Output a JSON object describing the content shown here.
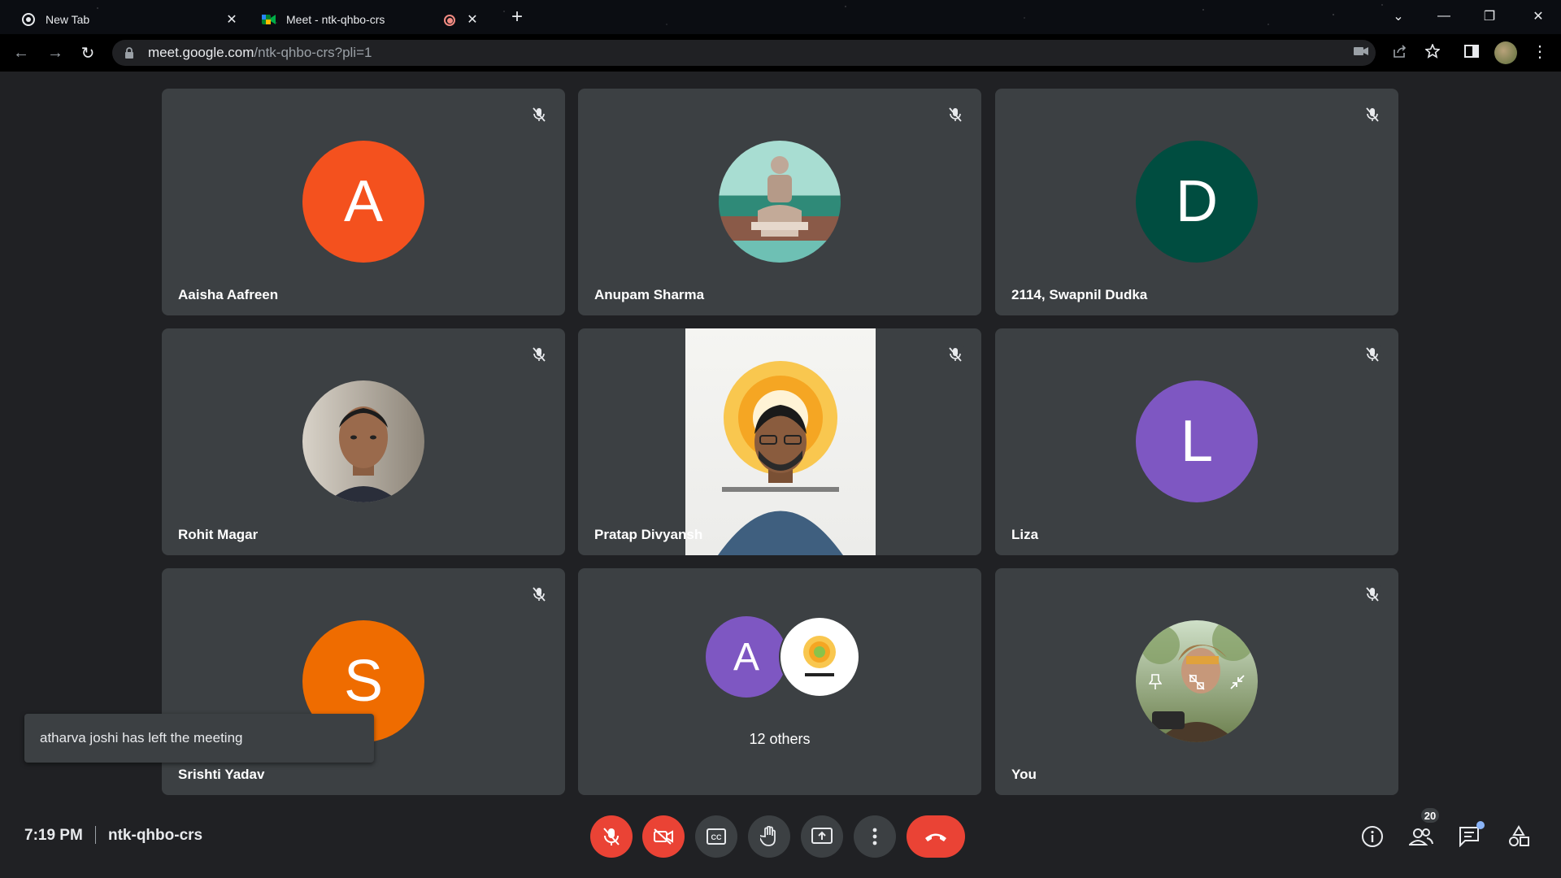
{
  "browser": {
    "tabs": [
      {
        "title": "New Tab",
        "icon": "chrome-icon"
      },
      {
        "title": "Meet - ntk-qhbo-crs",
        "icon": "meet-icon",
        "recording": true
      }
    ],
    "new_tab_label": "+",
    "url_host": "meet.google.com",
    "url_path": "/ntk-qhbo-crs?pli=1"
  },
  "tiles": [
    {
      "name": "Aaisha Aafreen",
      "avatar_type": "letter",
      "letter": "A",
      "color": "#f4511e"
    },
    {
      "name": "Anupam Sharma",
      "avatar_type": "photo",
      "photo": "buddha-statue"
    },
    {
      "name": "2114, Swapnil Dudka",
      "avatar_type": "letter",
      "letter": "D",
      "color": "#004d40"
    },
    {
      "name": "Rohit Magar",
      "avatar_type": "photo",
      "photo": "person-portrait"
    },
    {
      "name": "Pratap Divyansh",
      "avatar_type": "video"
    },
    {
      "name": "Liza",
      "avatar_type": "letter",
      "letter": "L",
      "color": "#7e57c2"
    },
    {
      "name": "Srishti Yadav",
      "avatar_type": "letter",
      "letter": "S",
      "color": "#ef6c00"
    },
    {
      "name": "12 others",
      "avatar_type": "group",
      "letter": "A",
      "color": "#7e57c2"
    },
    {
      "name": "You",
      "avatar_type": "photo",
      "photo": "self-portrait"
    }
  ],
  "toast": {
    "text": "atharva joshi has left the meeting"
  },
  "bottom_bar": {
    "time": "7:19 PM",
    "meeting_code": "ntk-qhbo-crs",
    "participants_count": "20"
  },
  "colors": {
    "accent_red": "#ea4335",
    "tile_bg": "#3c4043",
    "stage_bg": "#202124"
  }
}
